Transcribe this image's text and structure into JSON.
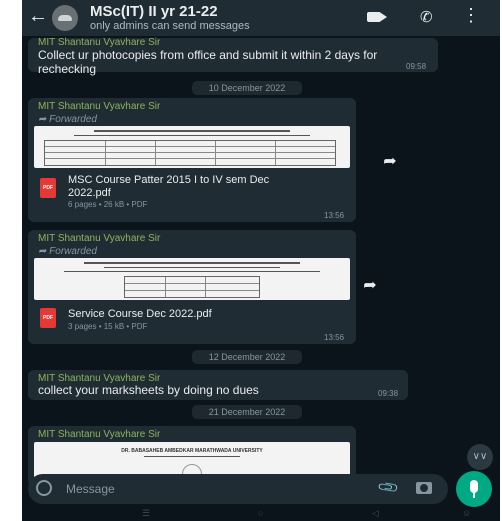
{
  "header": {
    "title": "MSc(IT) II yr 21-22",
    "subtitle": "only admins can send messages"
  },
  "messages": [
    {
      "sender": "MIT Shantanu Vyavhare Sir",
      "text": "Collect ur photocopies from office and submit it within 2 days for rechecking",
      "time": "09:58"
    },
    {
      "date_chip": "10 December 2022"
    },
    {
      "sender": "MIT Shantanu Vyavhare Sir",
      "forwarded": "Forwarded",
      "doc_name": "MSC Course  Patter 2015 I to IV sem Dec 2022.pdf",
      "doc_meta": "6 pages • 26 kB • PDF",
      "time": "13:56"
    },
    {
      "sender": "MIT Shantanu Vyavhare Sir",
      "forwarded": "Forwarded",
      "doc_name": "Service Course      Dec 2022.pdf",
      "doc_meta": "3 pages • 15 kB • PDF",
      "time": "13:56"
    },
    {
      "date_chip": "12 December 2022"
    },
    {
      "sender": "MIT Shantanu Vyavhare Sir",
      "text": "collect your marksheets by doing no dues",
      "time": "09:38"
    },
    {
      "date_chip": "21 December 2022"
    },
    {
      "sender": "MIT Shantanu Vyavhare Sir",
      "doc_preview_heading": "DR. BABASAHEB AMBEDKAR MARATHWADA UNIVERSITY"
    }
  ],
  "input": {
    "placeholder": "Message"
  },
  "pdf_label": "PDF",
  "colors": {
    "accent": "#00a884",
    "sender": "#8fb35c",
    "bubble": "#1f2c33",
    "background": "#0b141a"
  }
}
